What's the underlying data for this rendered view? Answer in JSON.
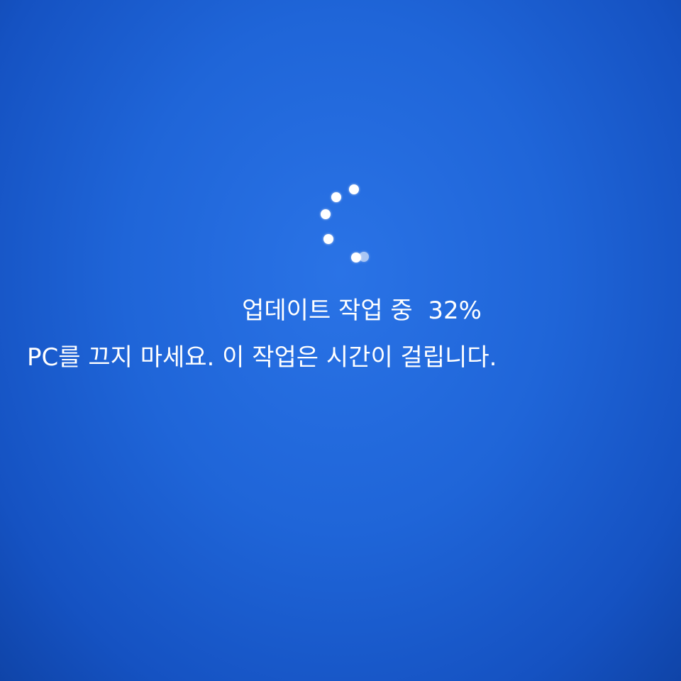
{
  "update_screen": {
    "status_text": "업데이트 작업 중",
    "progress_percent_label": "32%",
    "progress_percent": 32,
    "warning_text": "PC를 끄지 마세요. 이 작업은 시간이 걸립니다.",
    "spinner_icon": "loading-dots-spinner",
    "background_color": "#1f65d8",
    "text_color": "#ffffff"
  }
}
